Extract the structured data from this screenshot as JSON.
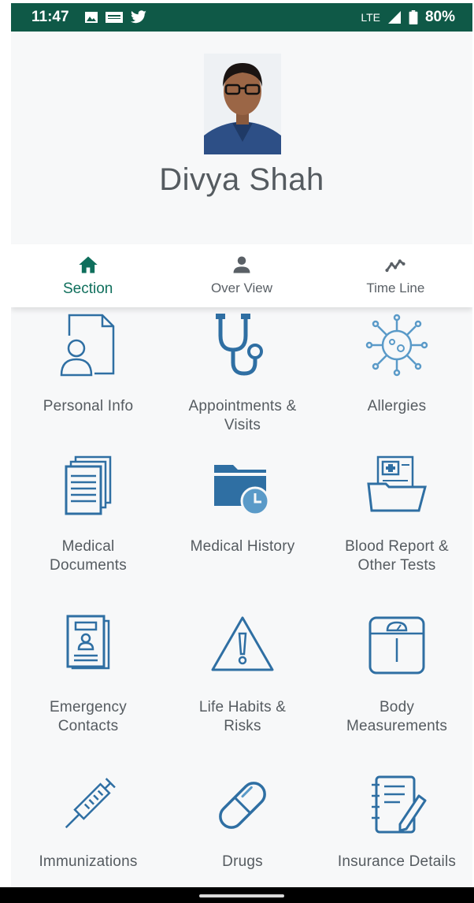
{
  "status_bar": {
    "time": "11:47",
    "network": "LTE",
    "battery": "80%",
    "bg_color": "#0f5947",
    "icons": [
      "image-icon",
      "news-icon",
      "twitter-icon",
      "signal-icon",
      "battery-icon"
    ]
  },
  "profile": {
    "name": "Divya Shah"
  },
  "tabs": [
    {
      "label": "Section",
      "icon": "home-icon",
      "active": true
    },
    {
      "label": "Over View",
      "icon": "person-icon",
      "active": false
    },
    {
      "label": "Time Line",
      "icon": "timeline-icon",
      "active": false
    }
  ],
  "sections": [
    {
      "label": "Personal Info",
      "icon": "personal-info-icon"
    },
    {
      "label": "Appointments &\nVisits",
      "icon": "stethoscope-icon"
    },
    {
      "label": "Allergies",
      "icon": "virus-icon"
    },
    {
      "label": "Medical\nDocuments",
      "icon": "documents-icon"
    },
    {
      "label": "Medical History",
      "icon": "folder-clock-icon"
    },
    {
      "label": "Blood Report &\nOther Tests",
      "icon": "medical-folder-icon"
    },
    {
      "label": "Emergency\nContacts",
      "icon": "contact-card-icon"
    },
    {
      "label": "Life Habits &\nRisks",
      "icon": "warning-icon"
    },
    {
      "label": "Body\nMeasurements",
      "icon": "scale-icon"
    },
    {
      "label": "Immunizations",
      "icon": "syringe-icon"
    },
    {
      "label": "Drugs",
      "icon": "pill-icon"
    },
    {
      "label": "Insurance Details",
      "icon": "notepad-pen-icon"
    }
  ],
  "colors": {
    "accent": "#0f6f5c",
    "icon_blue": "#2f6fa3",
    "icon_blue_light": "#5a9ac8",
    "text_gray": "#555b60"
  }
}
